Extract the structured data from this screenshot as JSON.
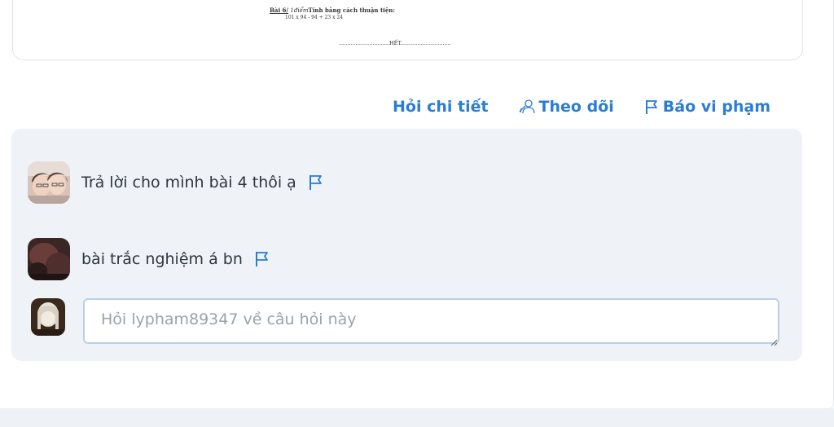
{
  "document_preview": {
    "exercise_label": "Bài 6/",
    "exercise_points": "1điểm",
    "exercise_title": "Tính bằng cách thuận tiện:",
    "expression": "101 x 94 - 94 + 23 x 24",
    "end_marker": "..............................HẾT.............................."
  },
  "actions": {
    "ask_detail": "Hỏi chi tiết",
    "follow": "Theo dõi",
    "report": "Báo vi phạm"
  },
  "comments": [
    {
      "text": "Trả lời cho mình bài 4 thôi ạ",
      "icon": "flag-icon"
    },
    {
      "text": "bài trắc nghiệm á bn",
      "icon": "flag-icon"
    }
  ],
  "reply": {
    "placeholder": "Hỏi lypham89347 về câu hỏi này",
    "value": ""
  },
  "colors": {
    "accent": "#2a7cd6",
    "panel": "#eff3f8",
    "input_border": "#b9d0e3"
  }
}
